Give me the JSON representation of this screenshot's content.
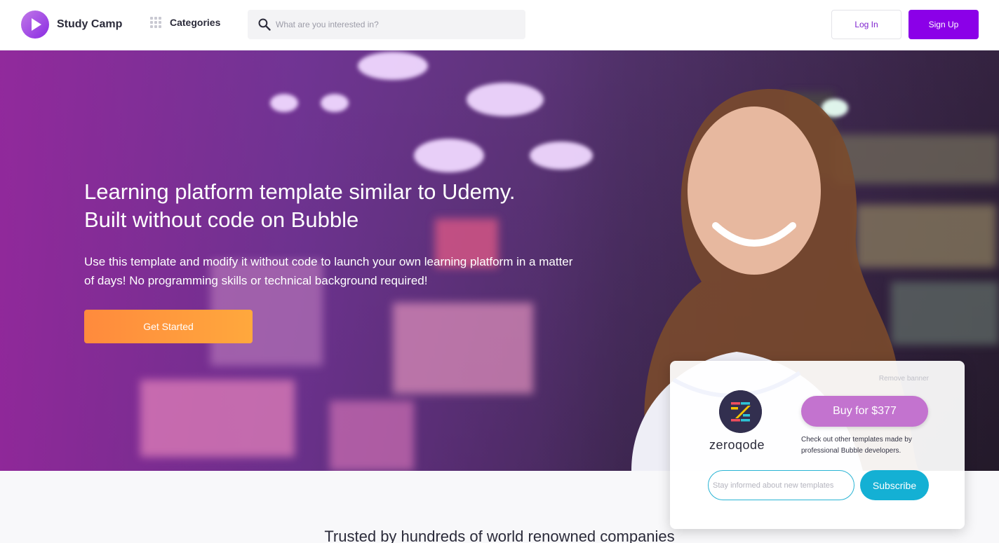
{
  "header": {
    "brand": "Study Camp",
    "categories_label": "Categories",
    "search_placeholder": "What are you interested in?",
    "login_label": "Log In",
    "signup_label": "Sign Up"
  },
  "hero": {
    "title_line1": "Learning platform template similar to Udemy.",
    "title_line2": "Built without code on Bubble",
    "subtitle": "Use this template and modify it without code to launch your own learning platform in a matter of days! No programming skills or technical background required!",
    "cta_label": "Get Started"
  },
  "trusted": {
    "heading": "Trusted by hundreds of world renowned companies"
  },
  "banner": {
    "remove_label": "Remove banner",
    "brand": "zeroqode",
    "buy_label": "Buy for  $377",
    "note": "Check out other templates made by professional Bubble developers.",
    "subscribe_placeholder": "Stay informed about new templates",
    "subscribe_label": "Subscribe"
  },
  "colors": {
    "accent": "#8b00e8",
    "cta_orange": "#ff9a3d",
    "buy_purple": "#c373cf",
    "subscribe_cyan": "#14b0d4"
  },
  "icons": {
    "logo": "play-icon",
    "categories": "grid-icon",
    "search": "search-icon",
    "banner_logo": "zeroqode-logo"
  }
}
